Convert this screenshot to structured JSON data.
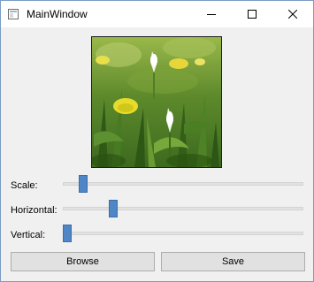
{
  "window": {
    "title": "MainWindow",
    "controls": {
      "minimize_icon": "minimize-icon",
      "maximize_icon": "maximize-icon",
      "close_icon": "close-icon"
    }
  },
  "image": {
    "description_icon": "flower-meadow-image"
  },
  "sliders": [
    {
      "label": "Scale:",
      "level": 0.07
    },
    {
      "label": "Horizontal:",
      "level": 0.2
    },
    {
      "label": "Vertical:",
      "level": 0.0
    }
  ],
  "buttons": {
    "browse_label": "Browse",
    "save_label": "Save"
  },
  "colors": {
    "accent": "#4f86c6",
    "window_bg": "#f0f0f0",
    "titlebar_bg": "#ffffff"
  }
}
